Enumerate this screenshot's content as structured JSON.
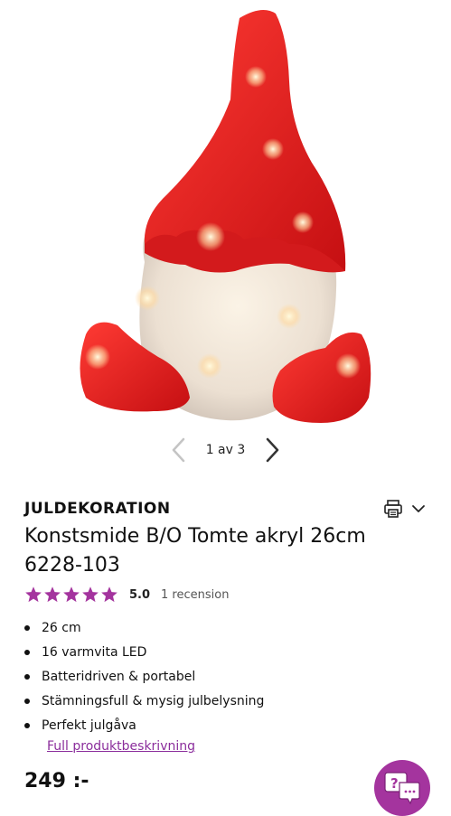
{
  "gallery": {
    "image_alt": "Konstsmide B/O Tomte akryl 26cm",
    "counter": "1 av 3"
  },
  "product": {
    "category": "JULDEKORATION",
    "title": "Konstsmide B/O Tomte akryl 26cm 6228-103",
    "rating": {
      "stars": 5,
      "score": "5.0",
      "reviews": "1 recension",
      "star_color": "#a4349e"
    },
    "features": [
      "26 cm",
      "16 varmvita LED",
      "Batteridriven & portabel",
      "Stämningsfull & mysig julbelysning",
      "Perfekt julgåva"
    ],
    "full_description_link": "Full produktbeskrivning",
    "price": "249 :-"
  },
  "icons": {
    "print": "print-icon",
    "expand": "chevron-down-icon",
    "prev": "chevron-left-icon",
    "next": "chevron-right-icon",
    "chat": "chat-icon"
  },
  "colors": {
    "accent": "#a4349e",
    "link": "#8b2e9c"
  }
}
